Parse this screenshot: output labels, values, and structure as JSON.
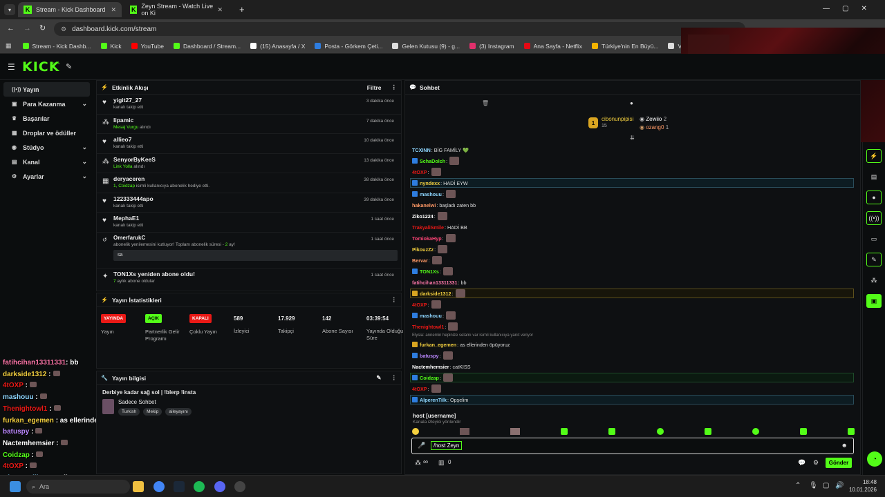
{
  "browser": {
    "tabs": [
      {
        "title": "Stream - Kick Dashboard"
      },
      {
        "title": "Zeyn Stream - Watch Live on Ki"
      }
    ],
    "url": "dashboard.kick.com/stream",
    "bookmarks": [
      {
        "label": "Stream - Kick Dashb...",
        "color": "#53fc18"
      },
      {
        "label": "Kick",
        "color": "#53fc18"
      },
      {
        "label": "YouTube",
        "color": "#ff0000"
      },
      {
        "label": "Dashboard / Stream...",
        "color": "#53fc18"
      },
      {
        "label": "(15) Anasayfa / X",
        "color": "#ffffff"
      },
      {
        "label": "Posta - Görkem Çeti...",
        "color": "#2e7de0"
      },
      {
        "label": "Gelen Kutusu (9) - g...",
        "color": "#dddddd"
      },
      {
        "label": "(3) Instagram",
        "color": "#e1306c"
      },
      {
        "label": "Ana Sayfa - Netflix",
        "color": "#e50914"
      },
      {
        "label": "Türkiye'nin En Büyü...",
        "color": "#f4b400"
      },
      {
        "label": "Venny Community",
        "color": "#dddddd"
      }
    ]
  },
  "site": {
    "logo": "KICK",
    "beta": "BETA"
  },
  "sidebar": {
    "items": [
      {
        "label": "Yayın",
        "icon": "broadcast-icon",
        "active": true,
        "chevron": false
      },
      {
        "label": "Para Kazanma",
        "icon": "money-icon",
        "active": false,
        "chevron": true
      },
      {
        "label": "Başarılar",
        "icon": "trophy-icon",
        "active": false,
        "chevron": false
      },
      {
        "label": "Droplar ve ödüller",
        "icon": "gift-icon",
        "active": false,
        "chevron": false
      },
      {
        "label": "Stüdyo",
        "icon": "studio-icon",
        "active": false,
        "chevron": true
      },
      {
        "label": "Kanal",
        "icon": "channel-icon",
        "active": false,
        "chevron": true
      },
      {
        "label": "Ayarlar",
        "icon": "gear-icon",
        "active": false,
        "chevron": true
      }
    ]
  },
  "activity": {
    "title": "Etkinlik Akışı",
    "filter": "Filtre",
    "items": [
      {
        "name": "yigit27_27",
        "desc": "kanalı takip etti",
        "time": "3 dakika önce",
        "icon": "heart-icon"
      },
      {
        "name": "lipamic",
        "hl": "Mesaj Vurgu",
        "desc": " alındı",
        "time": "7 dakika önce",
        "icon": "kicks-icon"
      },
      {
        "name": "allieo7",
        "desc": "kanalı takip etti",
        "time": "10 dakika önce",
        "icon": "heart-icon"
      },
      {
        "name": "SenyorByKeeS",
        "hl": "Link Yolla",
        "desc": " alındı",
        "time": "13 dakika önce",
        "icon": "kicks-icon"
      },
      {
        "name": "deryaceren",
        "hl": "1, Coidzap",
        "desc": " isimli kullanıcıya abonelik hediye etti.",
        "time": "38 dakika önce",
        "icon": "gift-icon"
      },
      {
        "name": "122333444apo",
        "desc": "kanalı takip etti",
        "time": "39 dakika önce",
        "icon": "heart-icon"
      },
      {
        "name": "MephaE1",
        "desc": "kanalı takip etti",
        "time": "1 saat önce",
        "icon": "heart-icon"
      }
    ],
    "resub": {
      "name": "OmerfarukC",
      "desc": "abonelik yenilemesini kutluyor! Toplam abonelik süresi - ",
      "months": "2",
      "unit": " ay!",
      "msg": "sa",
      "time": "1 saat önce"
    },
    "last": {
      "name": "TON1Xs yeniden abone oldu!",
      "hl": "7",
      "desc": " aylık abone oldular",
      "time": "1 saat önce"
    }
  },
  "stats": {
    "title": "Yayın İstatistikleri",
    "items": [
      {
        "badge": "YAYINDA",
        "color": "#e91916",
        "label": "Yayın"
      },
      {
        "badge": "AÇIK",
        "color": "#53fc18",
        "label": "Partnerlik Gelir Programı"
      },
      {
        "badge": "KAPALI",
        "color": "#e91916",
        "label": "Çoklu Yayın"
      },
      {
        "value": "589",
        "label": "İzleyici"
      },
      {
        "value": "17.929",
        "label": "Takipçi"
      },
      {
        "value": "142",
        "label": "Abone Sayısı"
      },
      {
        "value": "03:39:54",
        "label": "Yayında Olduğu Süre"
      }
    ]
  },
  "info": {
    "title": "Yayın bilgisi",
    "stream_title": "Derbiye kadar sağ sol | !blerp !insta",
    "category": "Sadece Sohbet",
    "tags": [
      "Turkish",
      "Mekip",
      "aileyayını"
    ]
  },
  "chat": {
    "title": "Sohbet",
    "pinned": [
      {
        "user": "cibonunpipisi",
        "count": "15"
      },
      {
        "user": "Zewiio",
        "count": "2"
      },
      {
        "user": "ozang0",
        "count": "1"
      }
    ],
    "messages": [
      {
        "user": "TCXINN",
        "color": "#8ed6ff",
        "text": ": BİG FAMİLY 💚",
        "emote": false,
        "hl": ""
      },
      {
        "user": "SchaDolch",
        "color": "#53fc18",
        "text": ":",
        "emote": true,
        "hl": ""
      },
      {
        "user": "4tOXP",
        "color": "#e91916",
        "text": ":",
        "emote": true,
        "hl": ""
      },
      {
        "user": "nyndexx",
        "color": "#f4d03f",
        "text": ": HADİ EYW",
        "emote": false,
        "hl": "blue"
      },
      {
        "user": "mashouu",
        "color": "#8ed6ff",
        "text": ":",
        "emote": true,
        "hl": ""
      },
      {
        "user": "hakanelwi",
        "color": "#ff9966",
        "text": ": başladı zaten bb",
        "emote": false,
        "hl": ""
      },
      {
        "user": "Ziko1224",
        "color": "#ffffff",
        "text": ":",
        "emote": true,
        "hl": ""
      },
      {
        "user": "TrakyaliSmile",
        "color": "#e91916",
        "text": ": HADİ BB",
        "emote": false,
        "hl": ""
      },
      {
        "user": "TomiokaHyp",
        "color": "#ff4477",
        "text": ":",
        "emote": true,
        "hl": ""
      },
      {
        "user": "PikouzZz",
        "color": "#f4d03f",
        "text": ":",
        "emote": true,
        "hl": ""
      },
      {
        "user": "Bervar",
        "color": "#ff9966",
        "text": ":",
        "emote": true,
        "hl": ""
      },
      {
        "user": "TON1Xs",
        "color": "#53fc18",
        "text": ":",
        "emote": true,
        "hl": ""
      },
      {
        "user": "fatihcihan13311331",
        "color": "#ff77aa",
        "text": ": bb",
        "emote": false,
        "hl": ""
      },
      {
        "user": "darkside1312",
        "color": "#f4d03f",
        "text": ":",
        "emote": true,
        "hl": "gold"
      },
      {
        "user": "4tOXP",
        "color": "#e91916",
        "text": ":",
        "emote": true,
        "hl": ""
      },
      {
        "user": "mashouu",
        "color": "#8ed6ff",
        "text": ":",
        "emote": true,
        "hl": ""
      },
      {
        "user": "Thenightowl1",
        "color": "#e91916",
        "text": ":",
        "emote": true,
        "hl": ""
      },
      {
        "user": "furkan_egemen",
        "color": "#f4d03f",
        "text": ": as ellerinden öpüyoruz",
        "emote": false,
        "hl": "",
        "reply": "Elysia: annemin hepinize selamı var isimli kullanıcıya yanıt veriyor"
      },
      {
        "user": "batuspy",
        "color": "#bb88ff",
        "text": ":",
        "emote": true,
        "hl": ""
      },
      {
        "user": "Nactemhemsier",
        "color": "#ffffff",
        "text": ": catKISS",
        "emote": false,
        "hl": ""
      },
      {
        "user": "Coidzap",
        "color": "#53fc18",
        "text": ":",
        "emote": true,
        "hl": "green"
      },
      {
        "user": "4tOXP",
        "color": "#e91916",
        "text": ":",
        "emote": true,
        "hl": ""
      },
      {
        "user": "AlperenTilk",
        "color": "#8ed6ff",
        "text": ": Opşelim",
        "emote": false,
        "hl": "blue"
      }
    ],
    "command": {
      "name": "host [username]",
      "desc": "Kanala izleyici yönlendir"
    },
    "input_value": "/host Zeyn",
    "send": "Gönder",
    "counters": {
      "loop": "∞",
      "slow": "0"
    }
  },
  "overlay": {
    "lines": [
      {
        "user": "fatihcihan13311331",
        "color": "#ff77aa",
        "text": ": bb"
      },
      {
        "user": "darkside1312",
        "color": "#f4d03f",
        "text": " :"
      },
      {
        "user": "4tOXP",
        "color": "#e91916",
        "text": " :"
      },
      {
        "user": "mashouu",
        "color": "#8ed6ff",
        "text": " :"
      },
      {
        "user": "Thenightowl1",
        "color": "#e91916",
        "text": " :"
      },
      {
        "user": "furkan_egemen",
        "color": "#f4d03f",
        "text": " : as ellerinden öpüyoruz"
      },
      {
        "user": "batuspy",
        "color": "#bb88ff",
        "text": " :"
      },
      {
        "user": "Nactemhemsier",
        "color": "#ffffff",
        "text": " :"
      },
      {
        "user": "Coidzap",
        "color": "#53fc18",
        "text": " :"
      },
      {
        "user": "4tOXP",
        "color": "#e91916",
        "text": " :"
      },
      {
        "user": "AlperenTilk",
        "color": "#8ed6ff",
        "text": " : Opşelim"
      },
      {
        "user": "SchaDolch",
        "color": "#53fc18",
        "text": " :"
      }
    ]
  },
  "taskbar": {
    "search": "Ara",
    "time": "18:48",
    "date": "10.01.2026"
  }
}
